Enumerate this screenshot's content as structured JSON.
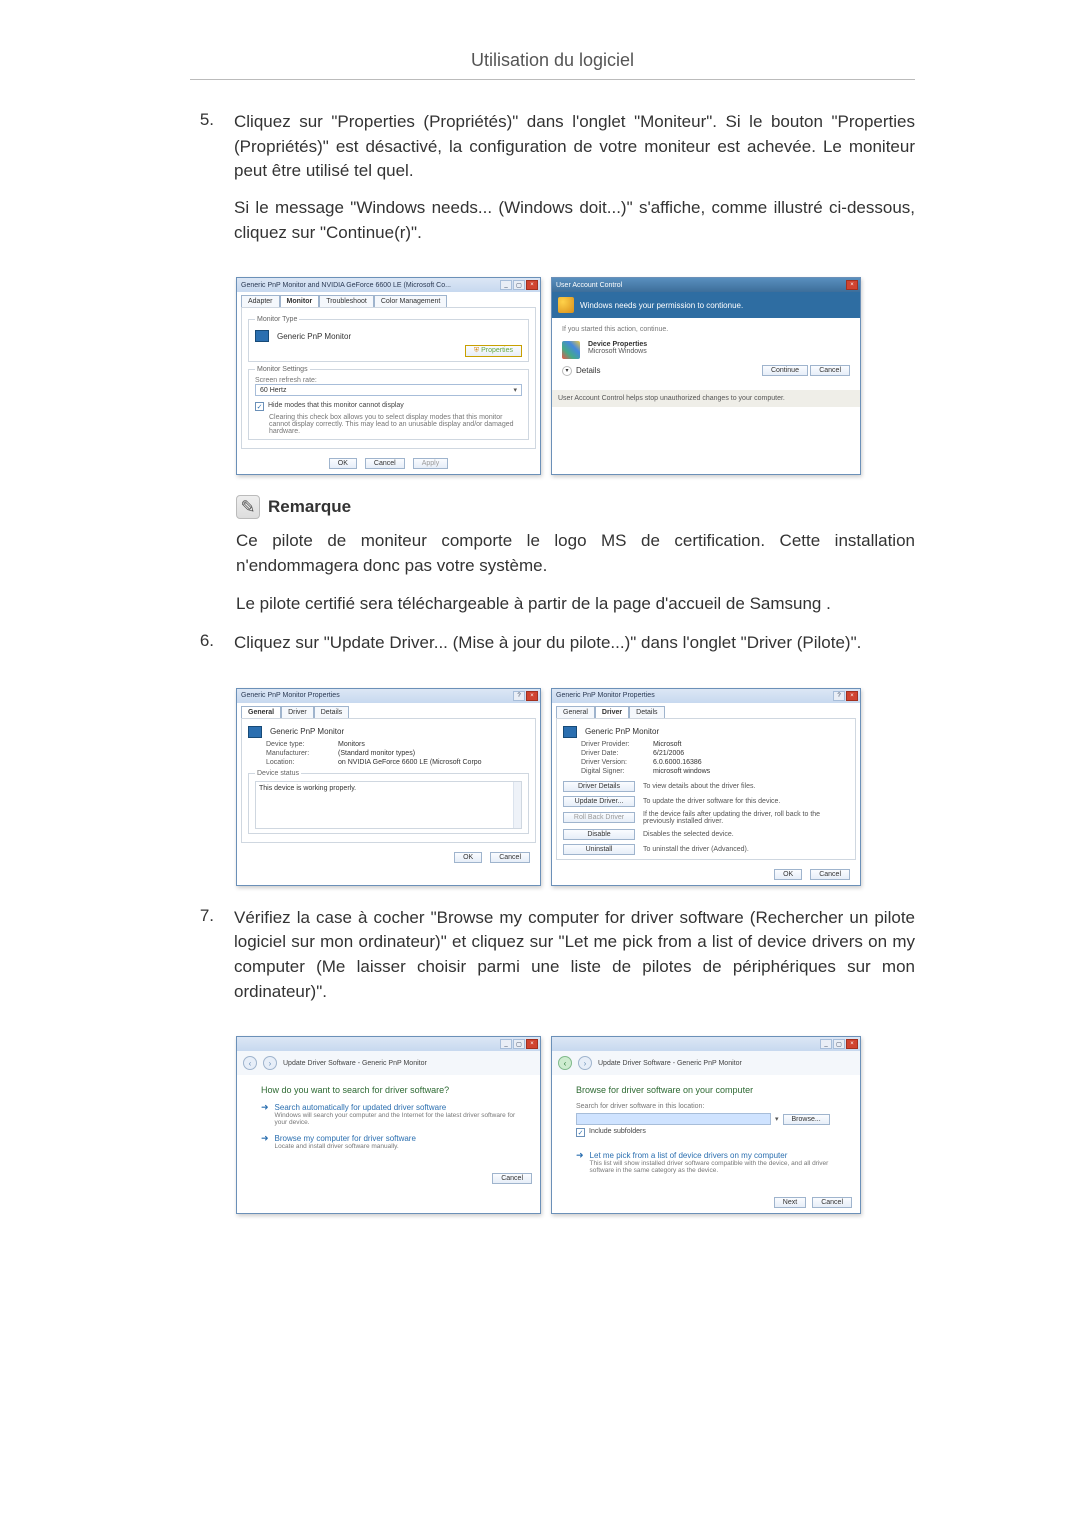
{
  "page_title": "Utilisation du logiciel",
  "steps": {
    "n5": "5.",
    "n6": "6.",
    "n7": "7.",
    "s5a": "Cliquez sur \"Properties (Propriétés)\" dans l'onglet \"Moniteur\". Si le bouton \"Properties (Propriétés)\" est désactivé, la configuration de votre moniteur est achevée. Le moniteur peut être utilisé tel quel.",
    "s5b": "Si le message \"Windows needs... (Windows doit...)\" s'affiche, comme illustré ci-dessous, cliquez sur \"Continue(r)\".",
    "s6": "Cliquez sur \"Update Driver... (Mise à jour du pilote...)\" dans l'onglet \"Driver (Pilote)\".",
    "s7": "Vérifiez la case à cocher \"Browse my computer for driver software (Rechercher un pilote logiciel sur mon ordinateur)\" et cliquez sur \"Let me pick from a list of device drivers on my computer (Me laisser choisir parmi une liste de pilotes de périphériques sur mon ordinateur)\"."
  },
  "note": {
    "title": "Remarque",
    "p1": "Ce pilote de moniteur comporte le logo MS de certification. Cette installation n'endommagera donc pas votre système.",
    "p2": "Le pilote certifié sera téléchargeable à partir de la page d'accueil de Samsung ."
  },
  "monitor_dialog": {
    "title": "Generic PnP Monitor and NVIDIA GeForce 6600 LE (Microsoft Co...",
    "tabs": {
      "adapter": "Adapter",
      "monitor": "Monitor",
      "trouble": "Troubleshoot",
      "color": "Color Management"
    },
    "section_type": "Monitor Type",
    "type_name": "Generic PnP Monitor",
    "properties_btn": "Properties",
    "section_settings": "Monitor Settings",
    "refresh_label": "Screen refresh rate:",
    "refresh_value": "60 Hertz",
    "hide_modes": "Hide modes that this monitor cannot display",
    "hide_note": "Clearing this check box allows you to select display modes that this monitor cannot display correctly. This may lead to an unusable display and/or damaged hardware.",
    "ok": "OK",
    "cancel": "Cancel",
    "apply": "Apply"
  },
  "uac": {
    "title": "User Account Control",
    "headline": "Windows needs your permission to contionue.",
    "started": "If you started this action, continue.",
    "app_name": "Device Properties",
    "publisher": "Microsoft Windows",
    "details": "Details",
    "continue": "Continue",
    "cancel": "Cancel",
    "footer": "User Account Control helps stop unauthorized changes to your computer."
  },
  "props_general": {
    "title": "Generic PnP Monitor Properties",
    "tabs": {
      "general": "General",
      "driver": "Driver",
      "details": "Details"
    },
    "name": "Generic PnP Monitor",
    "kv": {
      "type_k": "Device type:",
      "type_v": "Monitors",
      "mfr_k": "Manufacturer:",
      "mfr_v": "(Standard monitor types)",
      "loc_k": "Location:",
      "loc_v": "on NVIDIA GeForce 6600 LE (Microsoft Corpo"
    },
    "status_legend": "Device status",
    "status_text": "This device is working properly.",
    "ok": "OK",
    "cancel": "Cancel"
  },
  "props_driver": {
    "title": "Generic PnP Monitor Properties",
    "name": "Generic PnP Monitor",
    "kv": {
      "provider_k": "Driver Provider:",
      "provider_v": "Microsoft",
      "date_k": "Driver Date:",
      "date_v": "6/21/2006",
      "ver_k": "Driver Version:",
      "ver_v": "6.0.6000.16386",
      "signer_k": "Digital Signer:",
      "signer_v": "microsoft windows"
    },
    "actions": {
      "details": "Driver Details",
      "details_d": "To view details about the driver files.",
      "update": "Update Driver...",
      "update_d": "To update the driver software for this device.",
      "rollback": "Roll Back Driver",
      "rollback_d": "If the device fails after updating the driver, roll back to the previously installed driver.",
      "disable": "Disable",
      "disable_d": "Disables the selected device.",
      "uninstall": "Uninstall",
      "uninstall_d": "To uninstall the driver (Advanced)."
    },
    "ok": "OK",
    "cancel": "Cancel"
  },
  "wizard1": {
    "title": "Update Driver Software - Generic PnP Monitor",
    "h1": "How do you want to search for driver software?",
    "optA_t": "Search automatically for updated driver software",
    "optA_s": "Windows will search your computer and the Internet for the latest driver software for your device.",
    "optB_t": "Browse my computer for driver software",
    "optB_s": "Locate and install driver software manually.",
    "cancel": "Cancel"
  },
  "wizard2": {
    "title": "Update Driver Software - Generic PnP Monitor",
    "h1": "Browse for driver software on your computer",
    "search_label": "Search for driver software in this location:",
    "browse": "Browse...",
    "include": "Include subfolders",
    "optC_t": "Let me pick from a list of device drivers on my computer",
    "optC_s": "This list will show installed driver software compatible with the device, and all driver software in the same category as the device.",
    "next": "Next",
    "cancel": "Cancel"
  }
}
